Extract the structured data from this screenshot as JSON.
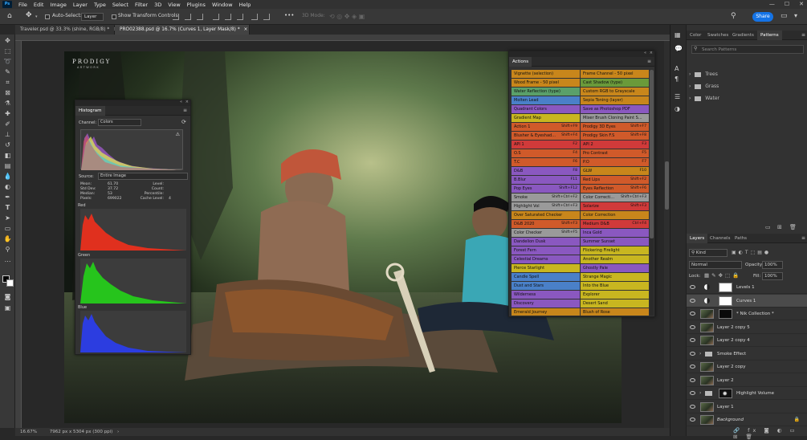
{
  "app": {
    "logo_text": "Ps"
  },
  "menu": [
    "File",
    "Edit",
    "Image",
    "Layer",
    "Type",
    "Select",
    "Filter",
    "3D",
    "View",
    "Plugins",
    "Window",
    "Help"
  ],
  "window_controls": [
    "—",
    "☐",
    "✕"
  ],
  "options": {
    "auto_select_label": "Auto-Select:",
    "layer_select_value": "Layer",
    "show_transform_label": "Show Transform Controls",
    "mode_3d_label": "3D Mode:",
    "more": "•••",
    "share_label": "Share"
  },
  "tabs": [
    {
      "label": "Traveler.psd @ 33.3% (shine, RGB/8) *",
      "close": "×"
    },
    {
      "label": "PRO02388.psd @ 16.7% (Curves 1, Layer Mask/8) *",
      "close": "×"
    }
  ],
  "canvas": {
    "watermark_title": "PRODIGY",
    "watermark_sub": "ARTWORK"
  },
  "status": {
    "zoom": "16.67%",
    "doc_info": "7962 px x 5304 px (300 ppi)"
  },
  "histogram": {
    "title": "Histogram",
    "channel_label": "Channel:",
    "channel_value": "Colors",
    "source_label": "Source:",
    "source_value": "Entire Image",
    "stats_left": [
      {
        "k": "Mean:",
        "v": "61.70"
      },
      {
        "k": "Std Dev:",
        "v": "37.72"
      },
      {
        "k": "Median:",
        "v": "53"
      },
      {
        "k": "Pixels:",
        "v": "699022"
      }
    ],
    "stats_right": [
      {
        "k": "Level:",
        "v": ""
      },
      {
        "k": "Count:",
        "v": ""
      },
      {
        "k": "Percentile:",
        "v": ""
      },
      {
        "k": "Cache Level:",
        "v": "4"
      }
    ],
    "channels": [
      "Red",
      "Green",
      "Blue"
    ],
    "colors": {
      "red": "#e0301e",
      "green": "#26c41c",
      "blue": "#2c3de0"
    }
  },
  "actions": {
    "title": "Actions",
    "items": [
      {
        "l": "Vignette (selection)",
        "k": "",
        "c": "#c8861b"
      },
      {
        "l": "Frame Channel - 50 pixel",
        "k": "",
        "c": "#c8861b"
      },
      {
        "l": "Wood Frame - 50 pixel",
        "k": "",
        "c": "#c8861b"
      },
      {
        "l": "Cast Shadow (type)",
        "k": "",
        "c": "#6a9a3a"
      },
      {
        "l": "Water Reflection (type)",
        "k": "",
        "c": "#5aa06a"
      },
      {
        "l": "Custom RGB to Grayscale",
        "k": "",
        "c": "#c8861b"
      },
      {
        "l": "Molten Lead",
        "k": "",
        "c": "#4a80c8"
      },
      {
        "l": "Sepia Toning (layer)",
        "k": "",
        "c": "#c8861b"
      },
      {
        "l": "Quadrant Colors",
        "k": "",
        "c": "#8a58c0"
      },
      {
        "l": "Save as Photoshop PDF",
        "k": "",
        "c": "#8a58c0"
      },
      {
        "l": "Gradient Map",
        "k": "",
        "c": "#c8b620"
      },
      {
        "l": "Mixer Brush Cloning Paint S...",
        "k": "",
        "c": "#9a9a9a"
      },
      {
        "l": "Action 1",
        "k": "Shift+F9",
        "c": "#d05a2a"
      },
      {
        "l": "Prodigy 3D Eyes",
        "k": "Shift+F7",
        "c": "#d05a2a"
      },
      {
        "l": "Blusher & Eyeshad...",
        "k": "Shift+F4",
        "c": "#d05a2a"
      },
      {
        "l": "Prodigy Skin F.S",
        "k": "Shift+F8",
        "c": "#d05a2a"
      },
      {
        "l": "API 1",
        "k": "F2",
        "c": "#d03a3a"
      },
      {
        "l": "API 2",
        "k": "F3",
        "c": "#d03a3a"
      },
      {
        "l": "O.S",
        "k": "F4",
        "c": "#d05a2a"
      },
      {
        "l": "Pro Contrast",
        "k": "F5",
        "c": "#d05a2a"
      },
      {
        "l": "T.C",
        "k": "F6",
        "c": "#d05a2a"
      },
      {
        "l": "P.O",
        "k": "F7",
        "c": "#d05a2a"
      },
      {
        "l": "D&B",
        "k": "F8",
        "c": "#8a58c0"
      },
      {
        "l": "GLW",
        "k": "F10",
        "c": "#c8861b"
      },
      {
        "l": "B.Blur",
        "k": "F11",
        "c": "#8a58c0"
      },
      {
        "l": "Red Lips",
        "k": "Shift+F2",
        "c": "#d05a2a"
      },
      {
        "l": "Pop Eyes",
        "k": "Shift+F12",
        "c": "#8a58c0"
      },
      {
        "l": "Eyes Reflection",
        "k": "Shift+F6",
        "c": "#d05a2a"
      },
      {
        "l": "Smoke",
        "k": "Shift+Ctrl+F2",
        "c": "#9a9a9a"
      },
      {
        "l": "Color Correcti...",
        "k": "Shift+Ctrl+F3",
        "c": "#9a9a9a"
      },
      {
        "l": "Highlight Vol",
        "k": "Shift+Ctrl+F3",
        "c": "#9a9a9a"
      },
      {
        "l": "Solarize",
        "k": "Shift+F3",
        "c": "#d03a3a"
      },
      {
        "l": "Over Saturated Checker",
        "k": "",
        "c": "#c8861b"
      },
      {
        "l": "Color Correction",
        "k": "",
        "c": "#c8861b"
      },
      {
        "l": "D&B 2020",
        "k": "Shift+F3",
        "c": "#d05a2a"
      },
      {
        "l": "Medium D&B",
        "k": "Ctrl+F4",
        "c": "#d03a3a"
      },
      {
        "l": "Color Checker",
        "k": "Shift+F5",
        "c": "#9a9a9a"
      },
      {
        "l": "Inca Gold",
        "k": "",
        "c": "#8a58c0"
      },
      {
        "l": "Dandelion Dusk",
        "k": "",
        "c": "#8a58c0"
      },
      {
        "l": "Summer Sunset",
        "k": "",
        "c": "#8a58c0"
      },
      {
        "l": "Forest Fern",
        "k": "",
        "c": "#8a58c0"
      },
      {
        "l": "Flickering Firelight",
        "k": "",
        "c": "#c8b620"
      },
      {
        "l": "Celestial Dreams",
        "k": "",
        "c": "#8a58c0"
      },
      {
        "l": "Another Realm",
        "k": "",
        "c": "#c8b620"
      },
      {
        "l": "Pierce Starlight",
        "k": "",
        "c": "#c8b620"
      },
      {
        "l": "Ghostly Pale",
        "k": "",
        "c": "#8a58c0"
      },
      {
        "l": "Candle Spell",
        "k": "",
        "c": "#4a80c8"
      },
      {
        "l": "Strange Magic",
        "k": "",
        "c": "#c8b620"
      },
      {
        "l": "Dust and Stars",
        "k": "",
        "c": "#4a80c8"
      },
      {
        "l": "Into the Blue",
        "k": "",
        "c": "#c8b620"
      },
      {
        "l": "Wilderness",
        "k": "",
        "c": "#8a58c0"
      },
      {
        "l": "Explorer",
        "k": "",
        "c": "#c8b620"
      },
      {
        "l": "Discovery",
        "k": "",
        "c": "#8a58c0"
      },
      {
        "l": "Desert Sand",
        "k": "",
        "c": "#c8b620"
      },
      {
        "l": "Emerald Journey",
        "k": "",
        "c": "#c8861b"
      },
      {
        "l": "Blush of Rose",
        "k": "",
        "c": "#c8861b"
      }
    ]
  },
  "patterns_panel": {
    "tabs": [
      "Color",
      "Swatches",
      "Gradients",
      "Patterns"
    ],
    "active_tab": "Patterns",
    "search_placeholder": "Search Patterns",
    "folders": [
      "Trees",
      "Grass",
      "Water"
    ]
  },
  "layers_panel": {
    "tabs": [
      "Layers",
      "Channels",
      "Paths"
    ],
    "active_tab": "Layers",
    "kind_value": "Kind",
    "blend_mode": "Normal",
    "opacity_label": "Opacity:",
    "opacity_value": "100%",
    "lock_label": "Lock:",
    "fill_label": "Fill:",
    "fill_value": "100%",
    "layers": [
      {
        "name": "Levels 1",
        "kind": "adjust",
        "selected": false
      },
      {
        "name": "Curves 1",
        "kind": "adjust",
        "selected": true
      },
      {
        "name": "* Nik Collection *",
        "kind": "photo",
        "selected": false
      },
      {
        "name": "Layer 2 copy 5",
        "kind": "photo",
        "selected": false
      },
      {
        "name": "Layer 2 copy 4",
        "kind": "photo",
        "selected": false
      },
      {
        "name": "Smoke Effect",
        "kind": "group",
        "selected": false
      },
      {
        "name": "Layer 2 copy",
        "kind": "photo",
        "selected": false
      },
      {
        "name": "Layer 2",
        "kind": "photo",
        "selected": false
      },
      {
        "name": "Highlight Volume",
        "kind": "group",
        "selected": false
      },
      {
        "name": "Layer 1",
        "kind": "photo",
        "selected": false
      },
      {
        "name": "Background",
        "kind": "photo",
        "selected": false,
        "italic": true
      }
    ]
  }
}
